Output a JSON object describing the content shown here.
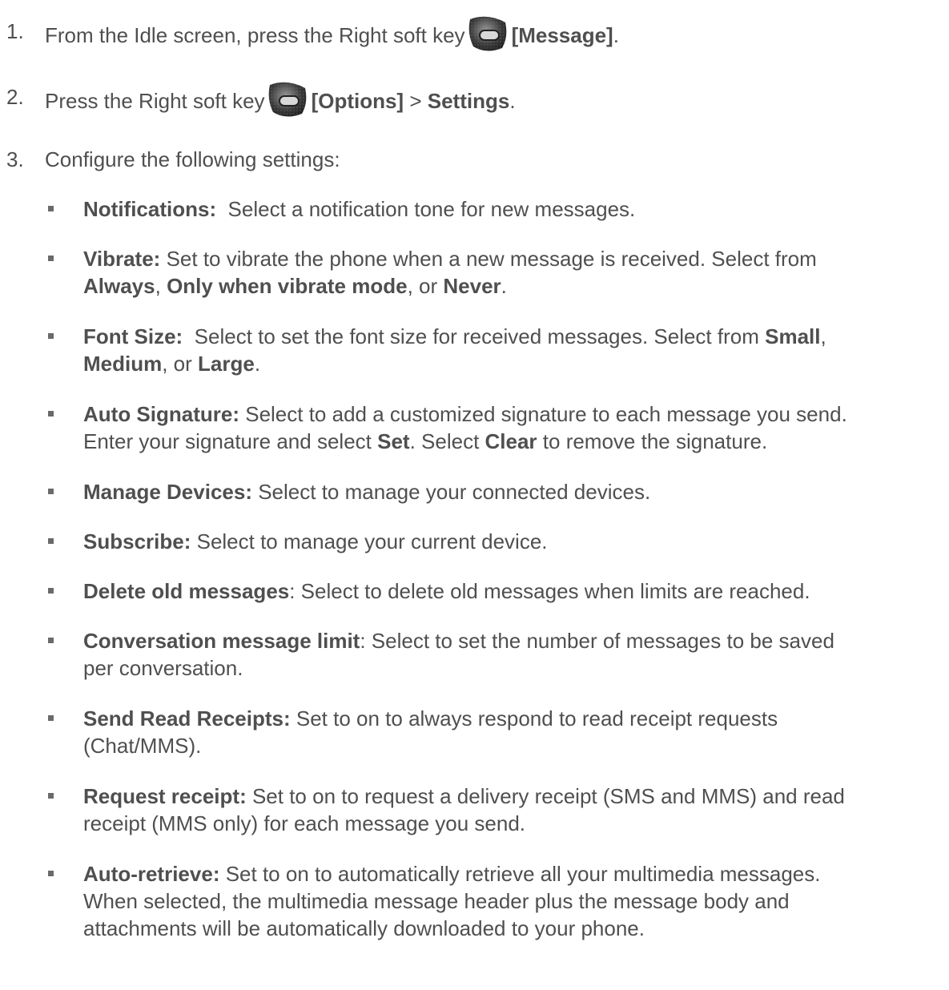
{
  "steps": [
    {
      "number": "1.",
      "text_before": "From the Idle screen, press the Right soft key",
      "key_icon": "right-soft-key-icon",
      "bold_label": "[Message]",
      "text_after": "."
    },
    {
      "number": "2.",
      "text_before": "Press the Right soft key",
      "key_icon": "right-soft-key-icon",
      "bold_label": "[Options]",
      "separator": " > ",
      "bold_label_2": "Settings",
      "text_after": "."
    },
    {
      "number": "3.",
      "text_before": "Configure the following settings:"
    }
  ],
  "settings": [
    {
      "term": "Notifications:",
      "line1": "  Select a notification tone for new messages."
    },
    {
      "term": "Vibrate:",
      "line1": " Set to vibrate the phone when a new message is received. Select from",
      "opt1": "Always",
      "sep1": ", ",
      "opt2": "Only when vibrate mode",
      "sep2": ", or ",
      "opt3": "Never",
      "end": "."
    },
    {
      "term": "Font Size:",
      "line1": "  Select to set the font size for received messages. Select from ",
      "opt1": "Small",
      "sep0": ",",
      "opt2": "Medium",
      "sep1": ", or ",
      "opt3": "Large",
      "end": "."
    },
    {
      "term": "Auto Signature:",
      "line1": " Select to add a customized signature to each message you send.",
      "l2a": "Enter your signature and select ",
      "opt1": "Set",
      "l2b": ". Select ",
      "opt2": "Clear",
      "l2c": " to remove the signature."
    },
    {
      "term": "Manage Devices:",
      "line1": " Select to manage your connected devices."
    },
    {
      "term": "Subscribe:",
      "line1": " Select to manage your current device."
    },
    {
      "term": "Delete old messages",
      "line1": ": Select to delete old messages when limits are reached."
    },
    {
      "term": "Conversation message limit",
      "line1": ": Select to set the number of messages to be saved",
      "line2": "per conversation."
    },
    {
      "term": "Send Read Receipts:",
      "line1": " Set to on to always respond to read receipt requests",
      "line2": "(Chat/MMS)."
    },
    {
      "term": "Request receipt:",
      "line1": " Set to on to request a delivery receipt (SMS and MMS) and read",
      "line2": "receipt (MMS only) for each message you send."
    },
    {
      "term": "Auto-retrieve:",
      "line1": " Set to on to automatically retrieve all your multimedia messages.",
      "line2": "When selected, the multimedia message header plus the message body and",
      "line3": "attachments will be automatically downloaded to your phone."
    }
  ],
  "colors": {
    "text": "#4f4f4f",
    "bullet": "#6a6a6a",
    "key_dark": "#2a2a2a",
    "key_light": "#9a9a9a"
  }
}
